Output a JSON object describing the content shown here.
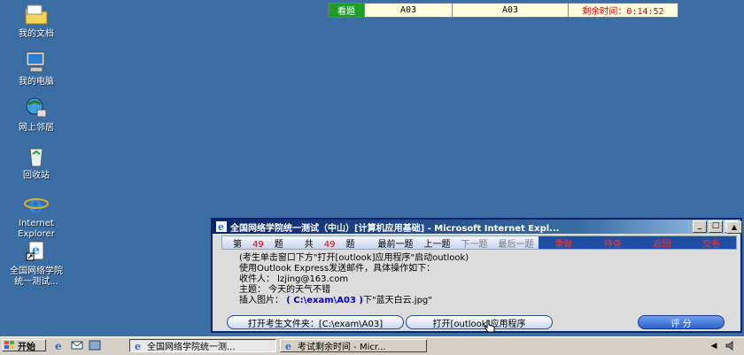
{
  "desktop": {
    "icons": [
      {
        "label": "我的文档",
        "icon": "folder-icon"
      },
      {
        "label": "我的电脑",
        "icon": "computer-icon"
      },
      {
        "label": "网上邻居",
        "icon": "network-icon"
      },
      {
        "label": "回收站",
        "icon": "recycle-bin-icon"
      },
      {
        "label": "Internet\nExplorer",
        "icon": "ie-icon"
      },
      {
        "label": "全国网络学院\n统一测试...",
        "icon": "shortcut-icon"
      }
    ]
  },
  "exam_bar": {
    "mode": "看题",
    "question_a": "A03",
    "question_b": "A03",
    "timer": "剩余时间：0:14:52"
  },
  "window": {
    "title": "全国网络学院统一测试（中山）[计算机应用基础] - Microsoft Internet Expl...",
    "controls": {
      "minimize": "_",
      "maximize": "□",
      "close": "×"
    },
    "nav": {
      "current_prefix": "第",
      "current_num": "49",
      "current_suffix": "题",
      "total_prefix": "共",
      "total_num": "49",
      "total_suffix": "题",
      "first": "最前一题",
      "prev": "上一题",
      "next": "下一题",
      "last": "最后一题",
      "redo": "重做",
      "review": "待查",
      "back": "返回",
      "submit": "交卷"
    },
    "content": {
      "line1": "(考生单击窗口下方\"打开[outlook]应用程序\"启动outlook)",
      "line2": "使用Outlook Express发送邮件，具体操作如下：",
      "line3": "收件人：  lzjing@163.com",
      "line4": "主题：  今天的天气不错",
      "line5_prefix": "插入图片：",
      "line5_path": "C:\\exam\\A03",
      "line5_suffix": "下\"蓝天白云.jpg\""
    },
    "buttons": {
      "open_folder": "打开考生文件夹：[C:\\exam\\A03]",
      "open_outlook": "打开[outlook]应用程序",
      "score": "评  分"
    }
  },
  "taskbar": {
    "start": "开始",
    "tasks": [
      "全国网络学院统一测...",
      "考试剩余时间 - Micr..."
    ]
  },
  "colors": {
    "desktop": "#3a6ea5",
    "mode_bg": "#1f9d2b",
    "timer_text": "#cc0000",
    "accent_red": "#ff3030"
  }
}
